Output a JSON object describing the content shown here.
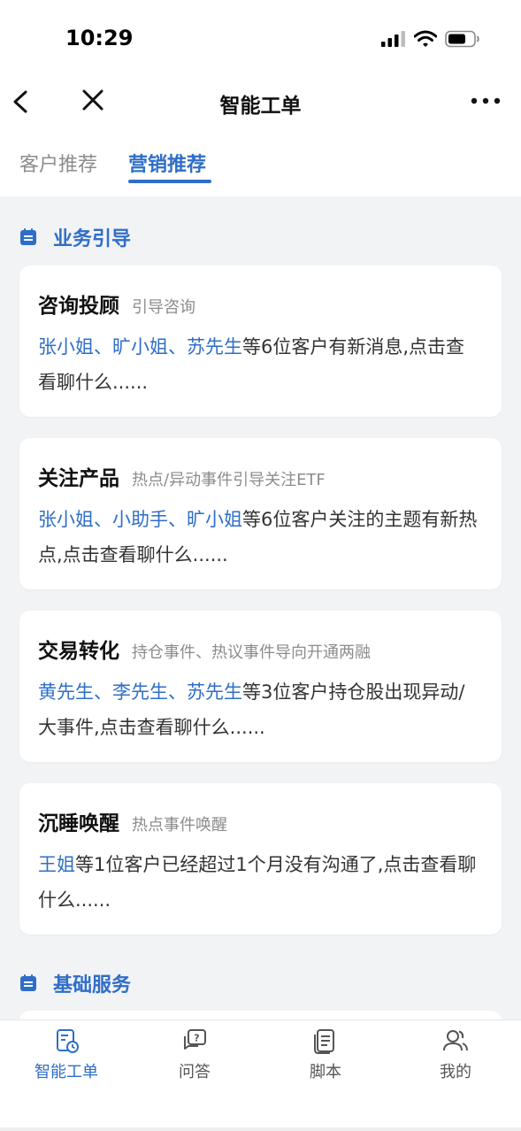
{
  "status_bar": {
    "time": "10:29"
  },
  "nav": {
    "title": "智能工单"
  },
  "tabs": [
    {
      "label": "客户推荐",
      "active": false
    },
    {
      "label": "营销推荐",
      "active": true
    }
  ],
  "sections": [
    {
      "title": "业务引导"
    },
    {
      "title": "基础服务"
    }
  ],
  "cards": [
    {
      "title": "咨询投顾",
      "tag": "引导咨询",
      "names": "张小姐、旷小姐、苏先生",
      "text": "等6位客户有新消息,点击查看聊什么......"
    },
    {
      "title": "关注产品",
      "tag": "热点/异动事件引导关注ETF",
      "names": "张小姐、小助手、旷小姐",
      "text": "等6位客户关注的主题有新热点,点击查看聊什么......"
    },
    {
      "title": "交易转化",
      "tag": "持仓事件、热议事件导向开通两融",
      "names": "黄先生、李先生、苏先生",
      "text": "等3位客户持仓股出现异动/大事件,点击查看聊什么......"
    },
    {
      "title": "沉睡唤醒",
      "tag": "热点事件唤醒",
      "names": "王姐",
      "text": "等1位客户已经超过1个月没有沟通了,点击查看聊什么......"
    }
  ],
  "tabbar": [
    {
      "label": "智能工单",
      "icon": "work-order-icon",
      "active": true
    },
    {
      "label": "问答",
      "icon": "qa-icon",
      "active": false
    },
    {
      "label": "脚本",
      "icon": "script-icon",
      "active": false
    },
    {
      "label": "我的",
      "icon": "profile-icon",
      "active": false
    }
  ],
  "colors": {
    "accent": "#2f6ec7",
    "background": "#f2f3f5",
    "muted": "#8c8c8c"
  }
}
